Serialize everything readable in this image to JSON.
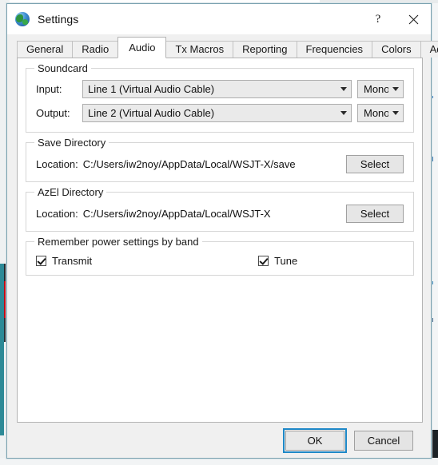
{
  "window": {
    "title": "Settings",
    "icon": "globe-icon",
    "help_label": "?",
    "close_label": "✕"
  },
  "tabs": [
    {
      "label": "General",
      "active": false
    },
    {
      "label": "Radio",
      "active": false
    },
    {
      "label": "Audio",
      "active": true
    },
    {
      "label": "Tx Macros",
      "active": false
    },
    {
      "label": "Reporting",
      "active": false
    },
    {
      "label": "Frequencies",
      "active": false
    },
    {
      "label": "Colors",
      "active": false
    },
    {
      "label": "Advanced",
      "active": false
    }
  ],
  "soundcard": {
    "group_title": "Soundcard",
    "input": {
      "label": "Input:",
      "device": "Line 1 (Virtual Audio Cable)",
      "channel": "Mono"
    },
    "output": {
      "label": "Output:",
      "device": "Line 2 (Virtual Audio Cable)",
      "channel": "Mono"
    }
  },
  "save_directory": {
    "group_title": "Save Directory",
    "location_label": "Location:",
    "path": "C:/Users/iw2noy/AppData/Local/WSJT-X/save",
    "select_label": "Select"
  },
  "azel_directory": {
    "group_title": "AzEl Directory",
    "location_label": "Location:",
    "path": "C:/Users/iw2noy/AppData/Local/WSJT-X",
    "select_label": "Select"
  },
  "power_settings": {
    "group_title": "Remember power settings by band",
    "transmit": {
      "label": "Transmit",
      "checked": true
    },
    "tune": {
      "label": "Tune",
      "checked": true
    }
  },
  "footer": {
    "ok_label": "OK",
    "cancel_label": "Cancel"
  },
  "colors": {
    "accent": "#1e88c7",
    "dialog_bg": "#f0f0f0",
    "page_bg": "#ffffff",
    "border": "#b4b4b4",
    "combo_bg": "#eaeaea"
  }
}
